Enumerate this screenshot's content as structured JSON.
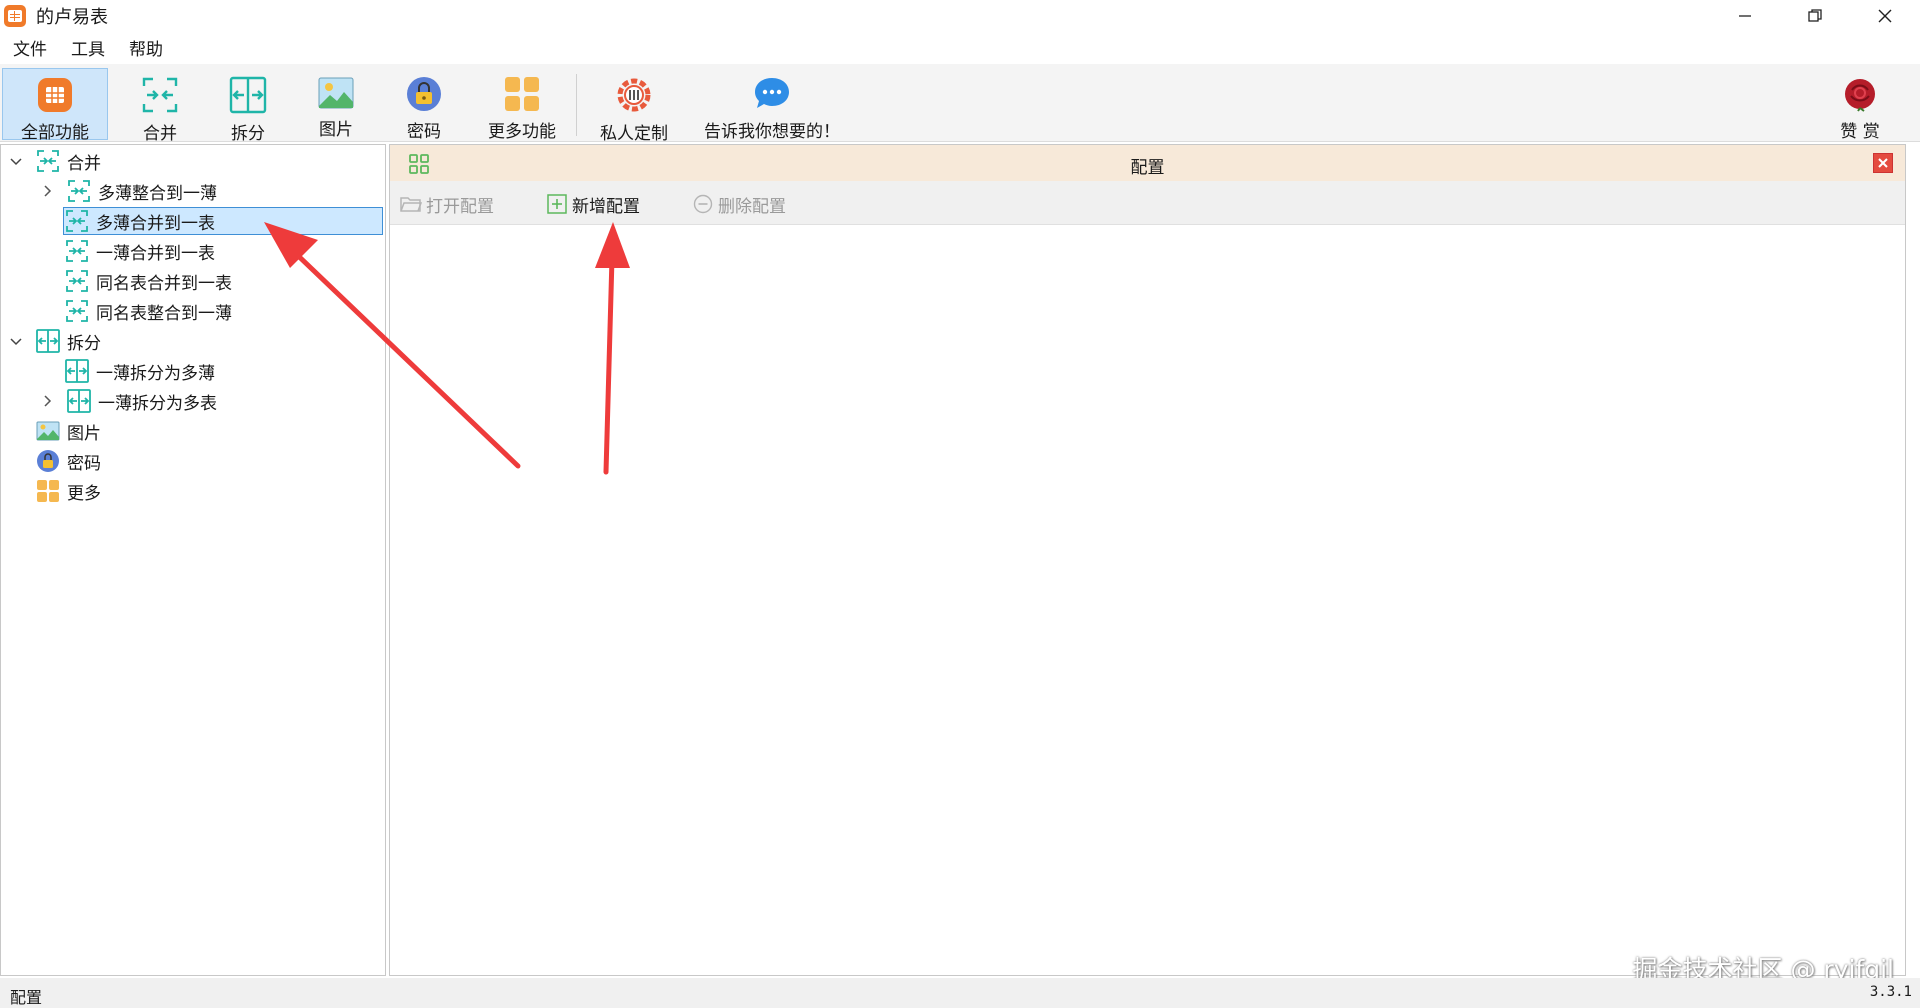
{
  "window": {
    "title": "的卢易表"
  },
  "menubar": {
    "items": [
      "文件",
      "工具",
      "帮助"
    ]
  },
  "toolbar": {
    "items": [
      {
        "label": "全部功能",
        "icon": "all-functions-icon",
        "active": true
      },
      {
        "label": "合并",
        "icon": "merge-icon"
      },
      {
        "label": "拆分",
        "icon": "split-icon"
      },
      {
        "label": "图片",
        "icon": "image-icon"
      },
      {
        "label": "密码",
        "icon": "lock-icon"
      },
      {
        "label": "更多功能",
        "icon": "more-icon"
      },
      {
        "label": "私人定制",
        "icon": "custom-icon"
      },
      {
        "label": "告诉我你想要的！",
        "icon": "chat-icon"
      },
      {
        "label": "赞 赏",
        "icon": "rose-icon"
      }
    ]
  },
  "tree": {
    "nodes": [
      {
        "label": "合并",
        "level": 0,
        "expanded": true,
        "icon": "merge-icon"
      },
      {
        "label": "多薄整合到一薄",
        "level": 1,
        "collapsed_children": true,
        "icon": "merge-icon"
      },
      {
        "label": "多薄合并到一表",
        "level": 1,
        "selected": true,
        "icon": "merge-icon"
      },
      {
        "label": "一薄合并到一表",
        "level": 1,
        "icon": "merge-icon"
      },
      {
        "label": "同名表合并到一表",
        "level": 1,
        "icon": "merge-icon"
      },
      {
        "label": "同名表整合到一薄",
        "level": 1,
        "icon": "merge-icon"
      },
      {
        "label": "拆分",
        "level": 0,
        "expanded": true,
        "icon": "split-icon"
      },
      {
        "label": "一薄拆分为多薄",
        "level": 1,
        "icon": "split-icon"
      },
      {
        "label": "一薄拆分为多表",
        "level": 1,
        "collapsed_children": true,
        "icon": "split-icon"
      },
      {
        "label": "图片",
        "level": 0,
        "icon": "image-icon"
      },
      {
        "label": "密码",
        "level": 0,
        "icon": "lock-icon"
      },
      {
        "label": "更多",
        "level": 0,
        "icon": "more-icon"
      }
    ]
  },
  "panel": {
    "title": "配置",
    "tools": [
      {
        "label": "打开配置",
        "icon": "folder-icon",
        "enabled": false
      },
      {
        "label": "新增配置",
        "icon": "plus-icon",
        "enabled": true
      },
      {
        "label": "删除配置",
        "icon": "minus-icon",
        "enabled": false
      }
    ]
  },
  "statusbar": {
    "left": "配置",
    "version": "3.3.1"
  },
  "watermark": "掘金技术社区 @ ryjfgjl",
  "colors": {
    "accent_orange": "#f07a2a",
    "teal_icon": "#1fb5a8",
    "selection_bg": "#cde8ff",
    "selection_border": "#3e8fd6",
    "panel_header_bg": "#f7e9d9",
    "arrow_red": "#ee3b3b"
  }
}
